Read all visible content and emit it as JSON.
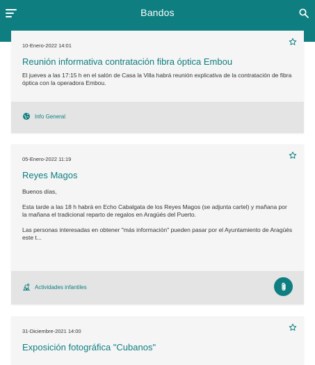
{
  "appbar": {
    "title": "Bandos",
    "menu_icon": "menu-icon",
    "search_icon": "search-icon"
  },
  "colors": {
    "primary": "#0e7e80",
    "card_bg": "#f5f5f5",
    "footer_bg": "#e4e4e4"
  },
  "items": [
    {
      "date": "10-Enero-2022 14:01",
      "title": "Reunión informativa contratación fibra óptica Embou",
      "text": [
        "El jueves a las 17:15 h en el salón de Casa la Villa habrá reunión explicativa de la contratación de fibra óptica con la operadora Embou."
      ],
      "category": "Info General",
      "category_icon": "globe-icon",
      "has_attachment": false
    },
    {
      "date": "05-Enero-2022 11:19",
      "title": "Reyes Magos",
      "text": [
        "Buenos días,",
        "Esta tarde a las 18 h habrá en Echo Cabalgata de los Reyes Magos (se adjunta cartel) y mañana por la mañana el tradicional reparto de regalos en Aragüés del Puerto.",
        "Las personas interesadas en obtener \"más información\" pueden pasar por el Ayuntamiento de Aragüés este t..."
      ],
      "category": "Actividades infantiles",
      "category_icon": "toy-icon",
      "has_attachment": true
    },
    {
      "date": "31-Diciembre-2021 14:00",
      "title": "Exposición fotográfica \"Cubanos\""
    }
  ]
}
